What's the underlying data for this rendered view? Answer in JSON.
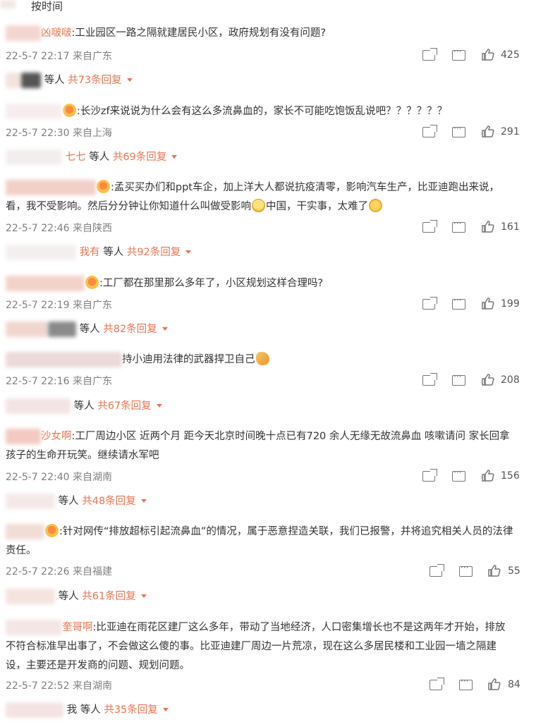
{
  "sort": {
    "label": "按时间"
  },
  "comments": [
    {
      "name": "凶啵啵",
      "text": "工业园区一路之隔就建居民小区，政府规划有没有问题?",
      "meta": "22-5-7 22:17 来自广东",
      "likes": "425",
      "reply_prefix": "等人",
      "reply_link": "共73条回复"
    },
    {
      "name": "",
      "text": "长沙zf来说说为什么会有这么多流鼻血的，家长不可能吃饱饭乱说吧？？？？？？",
      "meta": "22-5-7 22:30 来自上海",
      "likes": "291",
      "reply_names": "七七",
      "reply_prefix": "等人",
      "reply_link": "共69条回复"
    },
    {
      "name": "",
      "text_a": "孟买买办们和ppt车企，加上洋大人都说抗疫清零，影响汽车生产，比亚迪跑出来说，看，我不受影响。然后分分钟让你知道什么叫做受影响",
      "text_b": "中国，干实事，太难了",
      "meta": "22-5-7 22:46 来自陕西",
      "likes": "161",
      "reply_names": "我有",
      "reply_prefix": "等人",
      "reply_link": "共92条回复"
    },
    {
      "name": "",
      "text": "工厂都在那里那么多年了，小区规划这样合理吗?",
      "meta": "22-5-7 22:19 来自广东",
      "likes": "199",
      "reply_prefix": "等人",
      "reply_link": "共82条回复"
    },
    {
      "name": "",
      "text": "持小迪用法律的武器捍卫自己",
      "meta": "22-5-7 22:16 来自广东",
      "likes": "208",
      "reply_prefix": "等人",
      "reply_link": "共67条回复"
    },
    {
      "name": "沙女啊",
      "text": "工厂周边小区 近两个月 距今天北京时间晚十点已有720 余人无缘无故流鼻血 咳嗽请问 家长回拿孩子的生命开玩笑。继续请水军吧",
      "meta": "22-5-7 22:40 来自湖南",
      "likes": "156",
      "reply_prefix": "等人",
      "reply_link": "共48条回复"
    },
    {
      "name": "",
      "text": "针对网传“排放超标引起流鼻血”的情况，属于恶意捏造关联，我们已报警，并将追究相关人员的法律责任。",
      "meta": "22-5-7 22:26 来自福建",
      "likes": "55",
      "reply_prefix": "等人",
      "reply_link": "共61条回复"
    },
    {
      "name": "奎哥啊",
      "text": "比亚迪在雨花区建厂这么多年，带动了当地经济，人口密集增长也不是这两年才开始，排放不符合标准早出事了，不会做这么傻的事。比亚迪建厂周边一片荒凉，现在这么多居民楼和工业园一墙之隔建设，主要还是开发商的问题、规划问题。",
      "meta": "22-5-7 22:52 来自湖南",
      "likes": "84",
      "reply_names": "我",
      "reply_prefix": "等人",
      "reply_link": "共35条回复"
    }
  ],
  "colors": {
    "accent": "#eb7350",
    "meta": "#808080",
    "text": "#333333"
  },
  "icons": [
    "share-icon",
    "comment-icon",
    "like-icon"
  ]
}
